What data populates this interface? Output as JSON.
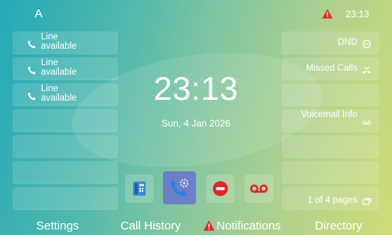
{
  "status_bar": {
    "account": "A",
    "time": "23:13",
    "alert_color": "#e0262c"
  },
  "line_keys": [
    {
      "label": "Line\navailable",
      "icon": "phone-icon"
    },
    {
      "label": "Line\navailable",
      "icon": "phone-icon"
    },
    {
      "label": "Line\navailable",
      "icon": "phone-icon"
    }
  ],
  "right_keys": {
    "dnd": {
      "label": "DND",
      "icon": "dnd-icon"
    },
    "missed_calls": {
      "label": "Missed Calls",
      "icon": "missed-call-icon"
    },
    "voicemail": {
      "label": "Voicemail Info",
      "icon": "voicemail-icon"
    },
    "page_indicator": {
      "label": "1 of 4 pages",
      "icon": "pages-icon"
    }
  },
  "clock": {
    "time": "23:13",
    "date": "Sun, 4 Jan 2026"
  },
  "dock": [
    {
      "name": "directory-app",
      "icon": "desk-phone-icon",
      "color": "#3d8ad6"
    },
    {
      "name": "call-settings-app",
      "icon": "phone-gear-icon",
      "color": "#2f7fe0",
      "active": true
    },
    {
      "name": "dnd-app",
      "icon": "no-entry-icon",
      "color": "#e0262c"
    },
    {
      "name": "voicemail-app",
      "icon": "voicemail-icon",
      "color": "#e0262c"
    }
  ],
  "softkeys": {
    "settings": "Settings",
    "call_history": "Call History",
    "notifications": "Notifications",
    "directory": "Directory"
  }
}
